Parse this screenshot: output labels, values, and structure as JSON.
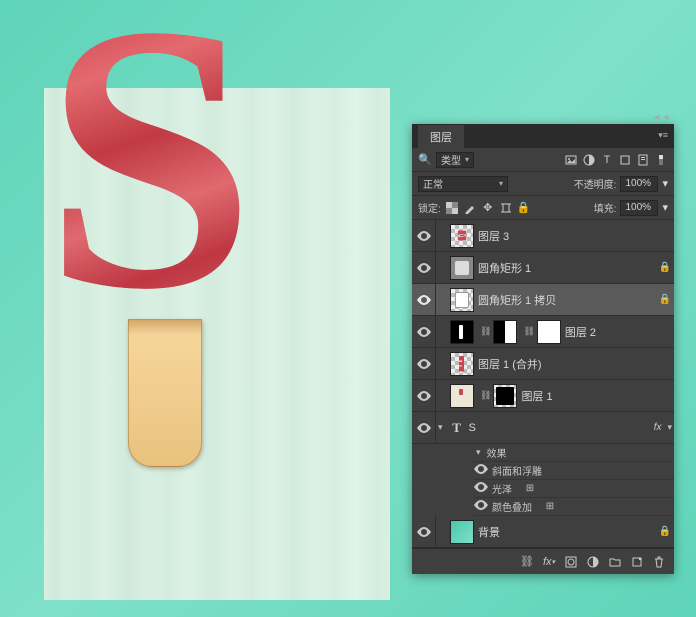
{
  "panel": {
    "title": "图层",
    "filter_label": "类型",
    "blend_mode": "正常",
    "opacity_label": "不透明度:",
    "opacity_value": "100%",
    "lock_label": "锁定:",
    "fill_label": "填充:",
    "fill_value": "100%"
  },
  "layers": [
    {
      "name": "图层 3"
    },
    {
      "name": "圆角矩形 1"
    },
    {
      "name": "圆角矩形 1 拷贝"
    },
    {
      "name": "图层 2"
    },
    {
      "name": "图层 1 (合并)"
    },
    {
      "name": "图层 1"
    },
    {
      "name": "S"
    },
    {
      "name": "背景"
    }
  ],
  "effects": {
    "header": "效果",
    "items": [
      "斜面和浮雕",
      "光泽",
      "颜色叠加"
    ]
  },
  "fx_indicator": "fx",
  "canvas_letter": "S"
}
